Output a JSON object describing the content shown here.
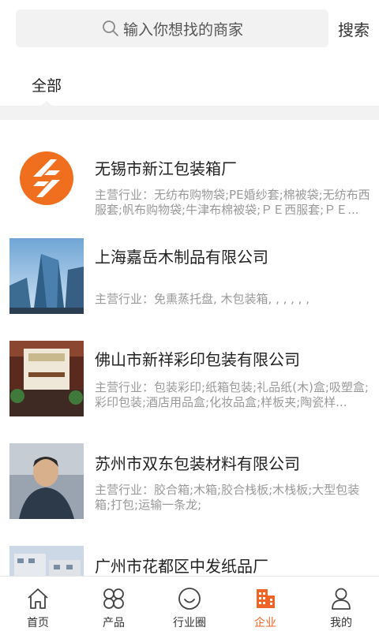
{
  "search": {
    "placeholder": "输入你想找的商家",
    "button_label": "搜索"
  },
  "tabs": [
    {
      "label": "全部"
    }
  ],
  "companies": [
    {
      "name": "无锡市新江包装箱厂",
      "desc": "主营行业：无纺布购物袋;PE婚纱套;棉被袋;无纺布西服套;帆布购物袋;牛津布棉被袋;ＰＥ西服套;ＰＥ..."
    },
    {
      "name": "上海嘉岳木制品有限公司",
      "desc": "主营行业：免熏蒸托盘, 木包装箱, , , , , ,"
    },
    {
      "name": "佛山市新祥彩印包装有限公司",
      "desc": "主营行业：包装彩印;纸箱包装;礼品纸(木)盒;吸塑盒;彩印包装;酒店用品盒;化妆品盒;样板夹;陶瓷样..."
    },
    {
      "name": "苏州市双东包装材料有限公司",
      "desc": "主营行业：胶合箱;木箱;胶合栈板;木栈板;大型包装箱;打包;运输一条龙;"
    },
    {
      "name": "广州市花都区中发纸品厂",
      "desc": ""
    }
  ],
  "nav": [
    {
      "label": "首页",
      "icon": "home-icon"
    },
    {
      "label": "产品",
      "icon": "products-icon"
    },
    {
      "label": "行业圈",
      "icon": "industry-circle-icon"
    },
    {
      "label": "企业",
      "icon": "enterprise-icon",
      "active": true
    },
    {
      "label": "我的",
      "icon": "profile-icon"
    }
  ],
  "colors": {
    "accent": "#f06427",
    "logo_orange": "#ef6f1f"
  }
}
